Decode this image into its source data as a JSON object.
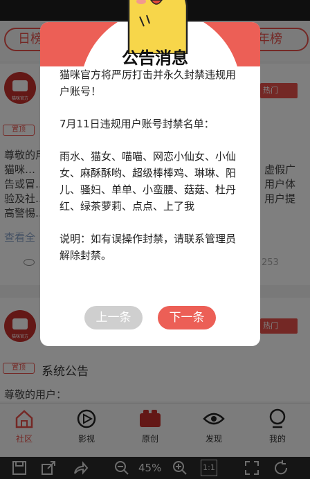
{
  "header": {
    "tab_left": "日榜",
    "tab_right": "年榜"
  },
  "post1": {
    "avatar_caption": "猫咪官方",
    "hot_badge": "热门",
    "tag": "置顶",
    "lines": [
      "尊敬的用户：",
      "    猫咪…",
      "告或冒…",
      "验及社…",
      "高警惕…"
    ],
    "lines_right": [
      "虚假广",
      "用户体",
      "用户提"
    ],
    "read_all": "查看全",
    "count": "253"
  },
  "post2": {
    "avatar_caption": "猫咪官方",
    "hot_badge": "热门",
    "tag": "置顶",
    "title": "系统公告",
    "line1": "尊敬的用户："
  },
  "bottom_nav": [
    {
      "label": "社区",
      "icon": "home-icon",
      "active": true
    },
    {
      "label": "影视",
      "icon": "play-icon",
      "active": false
    },
    {
      "label": "原创",
      "icon": "camera-icon",
      "active": false
    },
    {
      "label": "发现",
      "icon": "eye-icon",
      "active": false
    },
    {
      "label": "我的",
      "icon": "profile-icon",
      "active": false
    }
  ],
  "toolbar": {
    "zoom": "45%",
    "ratio": "1:1"
  },
  "modal": {
    "title": "公告消息",
    "intro": "猫咪官方将严厉打击并永久封禁违规用户账号！",
    "list_heading": "7月11日违规用户账号封禁名单：",
    "names": "雨水、猫女、喵喵、网恋小仙女、小仙女、麻酥酥哟、超级棒棒鸡、琳琳、阳儿、骚妇、单单、小蛮腰、菇菇、杜丹红、绿茶萝莉、点点、上了我",
    "note": "说明：如有误操作封禁，请联系管理员解除封禁。",
    "prev_button": "上一条",
    "next_button": "下一条"
  },
  "colors": {
    "accent": "#e8514a",
    "banner": "#ec5f56",
    "button_disabled": "#cfcfcf"
  }
}
